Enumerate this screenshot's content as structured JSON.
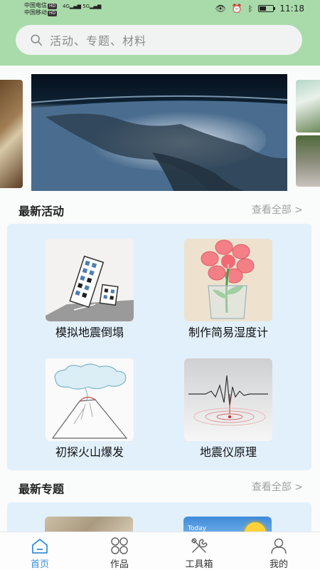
{
  "status_bar": {
    "carrier1": "中国电信",
    "carrier2": "中国移动",
    "hd": "HD",
    "signal1": "4G",
    "signal2": "5G",
    "time": "11:18"
  },
  "search": {
    "placeholder": "活动、专题、材料"
  },
  "sections": {
    "activities": {
      "title": "最新活动",
      "more": "查看全部 >"
    },
    "topics": {
      "title": "最新专题",
      "more": "查看全部 >"
    }
  },
  "activities": [
    {
      "label": "模拟地震倒塌",
      "icon": "collapsing-building"
    },
    {
      "label": "制作简易湿度计",
      "icon": "flower-in-glass"
    },
    {
      "label": "初探火山爆发",
      "icon": "volcano"
    },
    {
      "label": "地震仪原理",
      "icon": "seismograph"
    }
  ],
  "topic_thumb_text": "Today",
  "tabs": [
    {
      "label": "首页",
      "icon": "home-icon",
      "active": true
    },
    {
      "label": "作品",
      "icon": "grid-icon",
      "active": false
    },
    {
      "label": "工具箱",
      "icon": "tools-icon",
      "active": false
    },
    {
      "label": "我的",
      "icon": "user-icon",
      "active": false
    }
  ],
  "colors": {
    "header": "#a8dba9",
    "panel": "#e2f0fc",
    "active_tab": "#3b8fd8"
  }
}
